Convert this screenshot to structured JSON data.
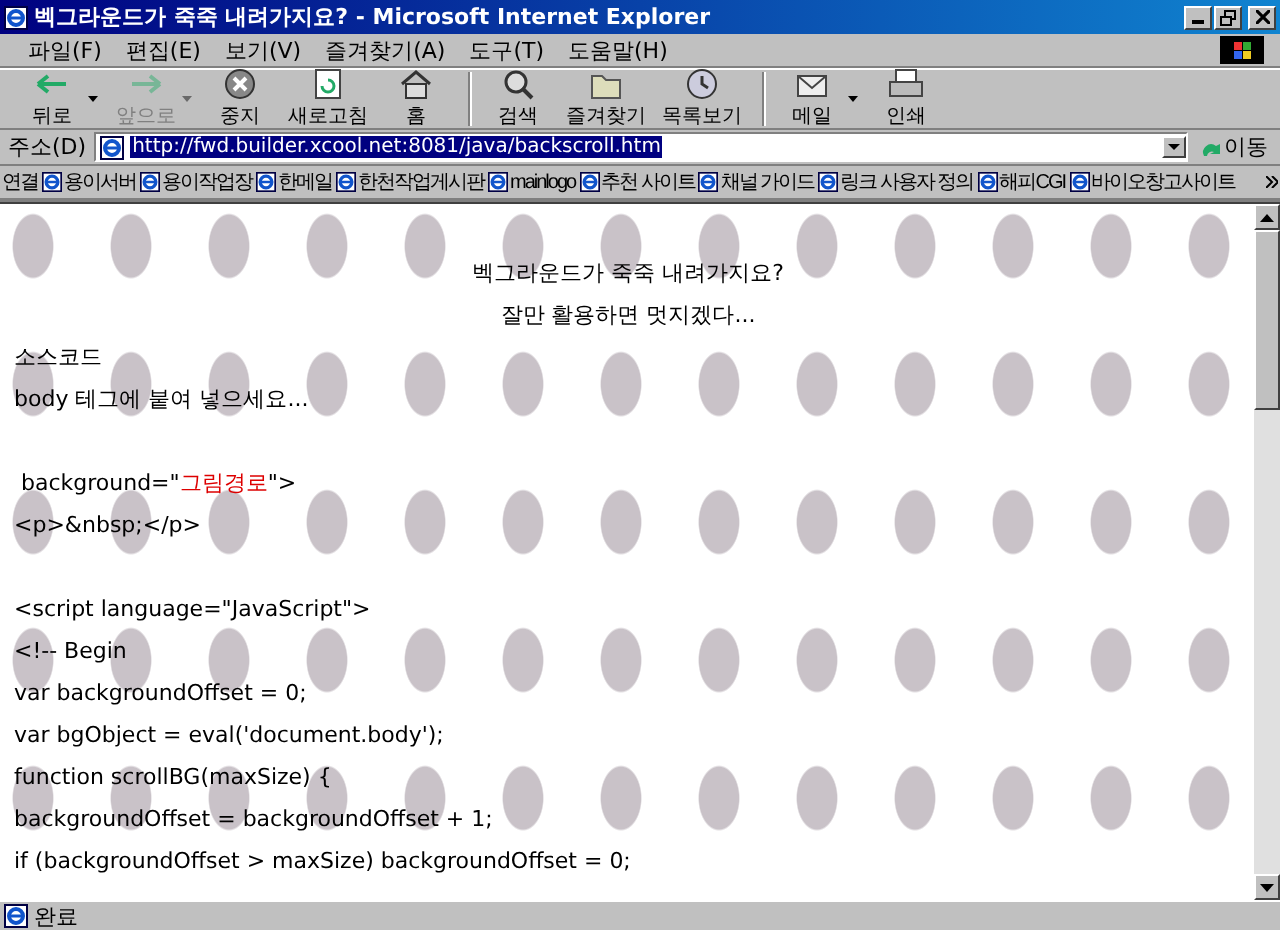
{
  "window": {
    "title": "벡그라운드가 죽죽 내려가지요? - Microsoft Internet Explorer"
  },
  "menu": [
    "파일(F)",
    "편집(E)",
    "보기(V)",
    "즐겨찾기(A)",
    "도구(T)",
    "도움말(H)"
  ],
  "toolbar": [
    {
      "kind": "back",
      "label": "뒤로",
      "disabled": false,
      "dropdown": true,
      "separator_before": false
    },
    {
      "kind": "forward",
      "label": "앞으로",
      "disabled": true,
      "dropdown": true,
      "separator_before": false
    },
    {
      "kind": "stop",
      "label": "중지",
      "disabled": false,
      "dropdown": false,
      "separator_before": false
    },
    {
      "kind": "refresh",
      "label": "새로고침",
      "disabled": false,
      "dropdown": false,
      "separator_before": false
    },
    {
      "kind": "home",
      "label": "홈",
      "disabled": false,
      "dropdown": false,
      "separator_before": false
    },
    {
      "kind": "search",
      "label": "검색",
      "disabled": false,
      "dropdown": false,
      "separator_before": true
    },
    {
      "kind": "favorites",
      "label": "즐겨찾기",
      "disabled": false,
      "dropdown": false,
      "separator_before": false
    },
    {
      "kind": "history",
      "label": "목록보기",
      "disabled": false,
      "dropdown": false,
      "separator_before": false
    },
    {
      "kind": "mail",
      "label": "메일",
      "disabled": false,
      "dropdown": true,
      "separator_before": true
    },
    {
      "kind": "print",
      "label": "인쇄",
      "disabled": false,
      "dropdown": false,
      "separator_before": false
    }
  ],
  "address": {
    "label": "주소(D)",
    "url": "http://fwd.builder.xcool.net:8081/java/backscroll.htm",
    "url_selected": true,
    "go": "이동"
  },
  "links": {
    "label": "연결",
    "items": [
      "용이서버",
      "용이작업장",
      "한메일",
      "한천작업게시판",
      "mainlogo",
      "추천 사이트",
      "채널 가이드",
      "링크 사용자 정의",
      "해피CGI",
      "바이오창고사이트"
    ]
  },
  "page": {
    "lines": [
      {
        "kind": "center",
        "text": "벡그라운드가 죽죽 내려가지요?",
        "blank_before": false
      },
      {
        "kind": "center",
        "text": "잘만 활용하면 멋지겠다...",
        "blank_before": false
      },
      {
        "kind": "left",
        "text": "소스코드",
        "blank_before": false
      },
      {
        "kind": "left",
        "text": "body 테그에 붙여 넣으세요...",
        "blank_before": false
      },
      {
        "kind": "left",
        "parts": [
          {
            "text": " background=\"",
            "color": "#000000"
          },
          {
            "text": "그림경로",
            "color": "#dd0000"
          },
          {
            "text": "\">",
            "color": "#000000"
          }
        ],
        "blank_before": true
      },
      {
        "kind": "left",
        "text": "<p>&nbsp;</p>",
        "blank_before": false
      },
      {
        "kind": "left",
        "text": "<script language=\"JavaScript\">",
        "blank_before": true
      },
      {
        "kind": "left",
        "text": "<!-- Begin",
        "blank_before": false
      },
      {
        "kind": "left",
        "text": "var backgroundOffset = 0;",
        "blank_before": false
      },
      {
        "kind": "left",
        "text": "var bgObject = eval('document.body');",
        "blank_before": false
      },
      {
        "kind": "left",
        "text": "function scrollBG(maxSize) {",
        "blank_before": false
      },
      {
        "kind": "left",
        "text": "backgroundOffset = backgroundOffset + 1;",
        "blank_before": false
      },
      {
        "kind": "left",
        "text": "if (backgroundOffset > maxSize) backgroundOffset = 0;",
        "blank_before": false
      }
    ]
  },
  "status": {
    "text": "완료"
  }
}
